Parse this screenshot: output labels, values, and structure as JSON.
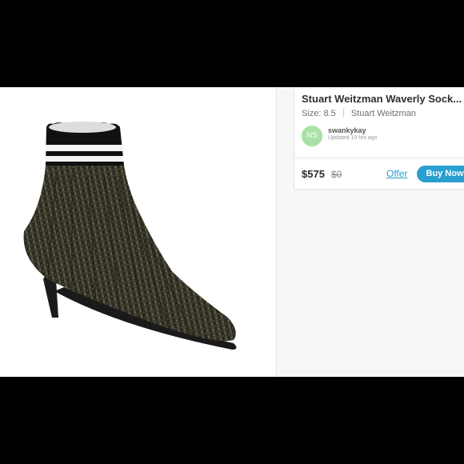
{
  "listing": {
    "title": "Stuart Weitzman Waverly Sock...",
    "size": "Size: 8.5",
    "brand": "Stuart Weitzman"
  },
  "seller": {
    "initials": "NS",
    "name": "swankykay",
    "updated": "Updated 19 hrs ago",
    "avatar_color": "#a9e1a7"
  },
  "pricing": {
    "price": "$575",
    "original_price": "$0"
  },
  "actions": {
    "offer_label": "Offer",
    "buy_label": "Buy Now"
  },
  "colors": {
    "accent": "#2a9fd0"
  }
}
